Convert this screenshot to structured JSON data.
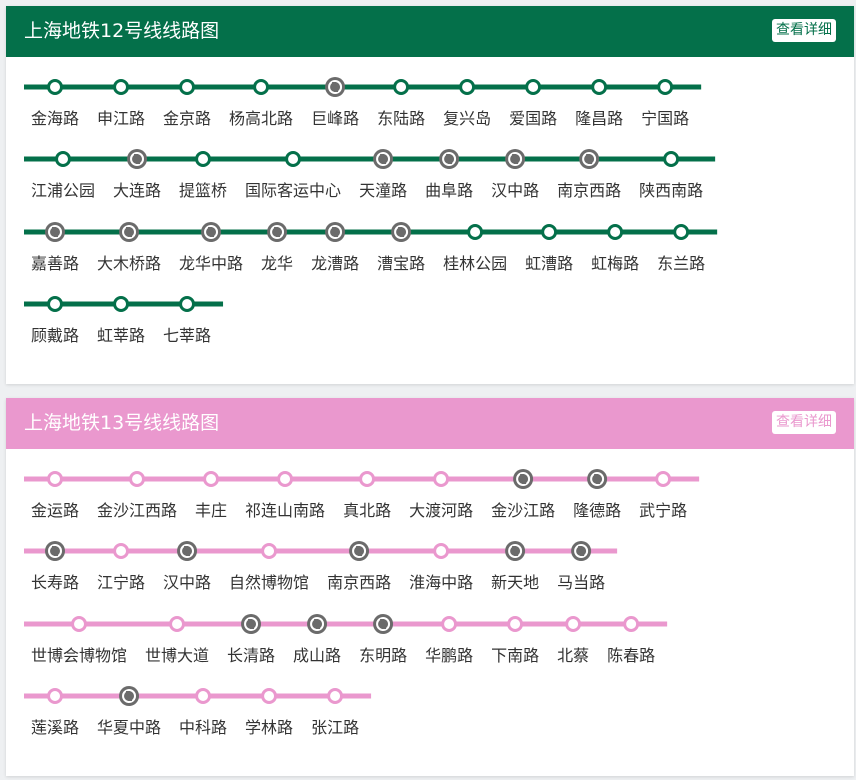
{
  "lines": [
    {
      "title": "上海地铁12号线线路图",
      "detail_label": "查看详细",
      "color": "#04704a",
      "stations": [
        {
          "name": "金海路",
          "transfer": false
        },
        {
          "name": "申江路",
          "transfer": false
        },
        {
          "name": "金京路",
          "transfer": false
        },
        {
          "name": "杨高北路",
          "transfer": false
        },
        {
          "name": "巨峰路",
          "transfer": true
        },
        {
          "name": "东陆路",
          "transfer": false
        },
        {
          "name": "复兴岛",
          "transfer": false
        },
        {
          "name": "爱国路",
          "transfer": false
        },
        {
          "name": "隆昌路",
          "transfer": false
        },
        {
          "name": "宁国路",
          "transfer": false
        },
        {
          "name": "江浦公园",
          "transfer": false
        },
        {
          "name": "大连路",
          "transfer": true
        },
        {
          "name": "提篮桥",
          "transfer": false
        },
        {
          "name": "国际客运中心",
          "transfer": false
        },
        {
          "name": "天潼路",
          "transfer": true
        },
        {
          "name": "曲阜路",
          "transfer": true
        },
        {
          "name": "汉中路",
          "transfer": true
        },
        {
          "name": "南京西路",
          "transfer": true
        },
        {
          "name": "陕西南路",
          "transfer": false
        },
        {
          "name": "嘉善路",
          "transfer": true
        },
        {
          "name": "大木桥路",
          "transfer": true
        },
        {
          "name": "龙华中路",
          "transfer": true
        },
        {
          "name": "龙华",
          "transfer": true
        },
        {
          "name": "龙漕路",
          "transfer": true
        },
        {
          "name": "漕宝路",
          "transfer": true
        },
        {
          "name": "桂林公园",
          "transfer": false
        },
        {
          "name": "虹漕路",
          "transfer": false
        },
        {
          "name": "虹梅路",
          "transfer": false
        },
        {
          "name": "东兰路",
          "transfer": false
        },
        {
          "name": "顾戴路",
          "transfer": false
        },
        {
          "name": "虹莘路",
          "transfer": false
        },
        {
          "name": "七莘路",
          "transfer": false
        }
      ]
    },
    {
      "title": "上海地铁13号线线路图",
      "detail_label": "查看详细",
      "color": "#ea98ce",
      "stations": [
        {
          "name": "金运路",
          "transfer": false
        },
        {
          "name": "金沙江西路",
          "transfer": false
        },
        {
          "name": "丰庄",
          "transfer": false
        },
        {
          "name": "祁连山南路",
          "transfer": false
        },
        {
          "name": "真北路",
          "transfer": false
        },
        {
          "name": "大渡河路",
          "transfer": false
        },
        {
          "name": "金沙江路",
          "transfer": true
        },
        {
          "name": "隆德路",
          "transfer": true
        },
        {
          "name": "武宁路",
          "transfer": false
        },
        {
          "name": "长寿路",
          "transfer": true
        },
        {
          "name": "江宁路",
          "transfer": false
        },
        {
          "name": "汉中路",
          "transfer": true
        },
        {
          "name": "自然博物馆",
          "transfer": false
        },
        {
          "name": "南京西路",
          "transfer": true
        },
        {
          "name": "淮海中路",
          "transfer": false
        },
        {
          "name": "新天地",
          "transfer": true
        },
        {
          "name": "马当路",
          "transfer": true
        },
        {
          "name": "世博会博物馆",
          "transfer": false
        },
        {
          "name": "世博大道",
          "transfer": false
        },
        {
          "name": "长清路",
          "transfer": true
        },
        {
          "name": "成山路",
          "transfer": true
        },
        {
          "name": "东明路",
          "transfer": true
        },
        {
          "name": "华鹏路",
          "transfer": false
        },
        {
          "name": "下南路",
          "transfer": false
        },
        {
          "name": "北蔡",
          "transfer": false
        },
        {
          "name": "陈春路",
          "transfer": false
        },
        {
          "name": "莲溪路",
          "transfer": false
        },
        {
          "name": "华夏中路",
          "transfer": true
        },
        {
          "name": "中科路",
          "transfer": false
        },
        {
          "name": "学林路",
          "transfer": false
        },
        {
          "name": "张江路",
          "transfer": false
        }
      ]
    }
  ]
}
